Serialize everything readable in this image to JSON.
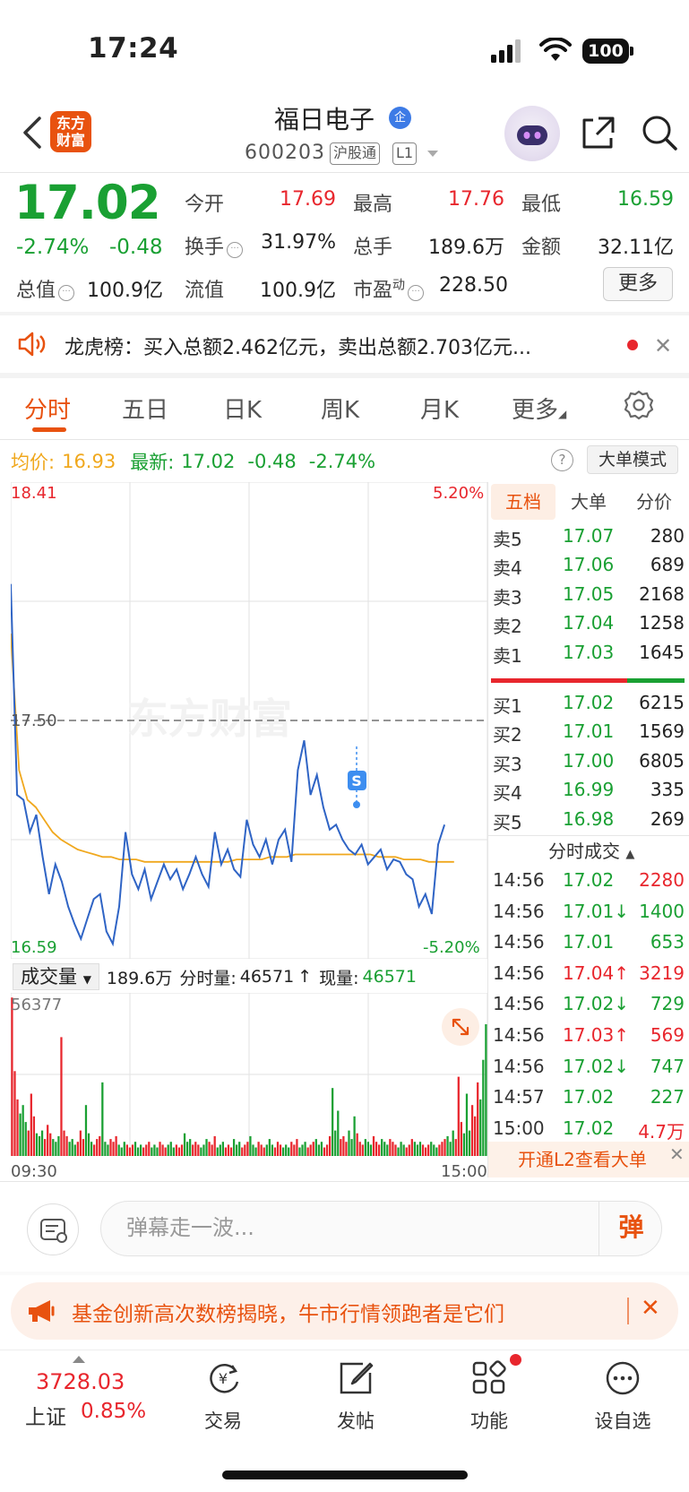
{
  "status_bar": {
    "time": "17:24",
    "battery": "100"
  },
  "header": {
    "logo_text_line1": "东方",
    "logo_text_line2": "财富",
    "stock_name": "福日电子",
    "qi_badge": "企",
    "stock_code": "600203",
    "tag_market": "沪股通",
    "tag_level": "L1"
  },
  "quote": {
    "price": "17.02",
    "change_pct": "-2.74%",
    "change_abs": "-0.48",
    "open_label": "今开",
    "open": "17.69",
    "high_label": "最高",
    "high": "17.76",
    "low_label": "最低",
    "low": "16.59",
    "turnover_label": "换手",
    "turnover": "31.97%",
    "volume_label": "总手",
    "volume": "189.6万",
    "amount_label": "金额",
    "amount": "32.11亿",
    "mktcap_label": "总值",
    "mktcap": "100.9亿",
    "float_label": "流值",
    "float_cap": "100.9亿",
    "pe_label": "市盈",
    "pe_sup": "动",
    "pe": "228.50",
    "more_label": "更多"
  },
  "notice": {
    "text": "龙虎榜：买入总额2.462亿元，卖出总额2.703亿元..."
  },
  "tabs": [
    "分时",
    "五日",
    "日K",
    "周K",
    "月K",
    "更多"
  ],
  "avg_bar": {
    "avg_label": "均价:",
    "avg": "16.93",
    "latest_label": "最新:",
    "latest": "17.02",
    "latest_chg": "-0.48",
    "latest_pct": "-2.74%",
    "help": "?",
    "big_order_mode": "大单模式"
  },
  "chart_labels": {
    "y_top": "18.41",
    "y_mid": "17.50",
    "y_bottom": "16.59",
    "pct_top": "5.20%",
    "pct_bottom": "-5.20%",
    "marker": "S",
    "watermark": "东方财富",
    "vol_dropdown": "成交量",
    "vol_total": "189.6万",
    "vol_fenshi_label": "分时量:",
    "vol_fenshi": "46571",
    "vol_arrow": "↑",
    "vol_now_label": "现量:",
    "vol_now": "46571",
    "vol_max": "56377",
    "x_start": "09:30",
    "x_end": "15:00"
  },
  "chart_data": {
    "type": "line",
    "title": "",
    "ylim": [
      16.59,
      18.41
    ],
    "reference_price": 17.5,
    "series": [
      {
        "name": "",
        "color": "#2f64c5",
        "values": [
          18.05,
          17.2,
          17.18,
          17.05,
          17.12,
          16.95,
          16.8,
          16.92,
          16.85,
          16.75,
          16.68,
          16.62,
          16.7,
          16.78,
          16.8,
          16.65,
          16.6,
          16.75,
          17.05,
          16.88,
          16.82,
          16.9,
          16.78,
          16.85,
          16.92,
          16.86,
          16.9,
          16.82,
          16.88,
          16.95,
          16.88,
          16.83,
          17.05,
          16.92,
          16.98,
          16.9,
          16.87,
          17.1,
          17.0,
          16.95,
          17.02,
          16.92,
          17.02,
          17.06,
          16.93,
          17.3,
          17.42,
          17.2,
          17.28,
          17.15,
          17.06,
          17.08,
          17.02,
          16.98,
          16.96,
          17.0,
          16.92,
          16.95,
          16.98,
          16.9,
          16.94,
          16.93,
          16.88,
          16.86,
          16.75,
          16.8,
          16.72,
          17.0,
          17.08
        ]
      },
      {
        "name": "均价",
        "color": "#f0a81e",
        "values": [
          17.85,
          17.3,
          17.18,
          17.15,
          17.1,
          17.05,
          17.02,
          17.0,
          16.98,
          16.97,
          16.96,
          16.95,
          16.95,
          16.94,
          16.94,
          16.94,
          16.93,
          16.93,
          16.93,
          16.93,
          16.93,
          16.93,
          16.93,
          16.93,
          16.93,
          16.93,
          16.93,
          16.94,
          16.94,
          16.94,
          16.94,
          16.95,
          16.95,
          16.95,
          16.96,
          16.96,
          16.96,
          16.96,
          16.96,
          16.96,
          16.96,
          16.96,
          16.96,
          16.96,
          16.95,
          16.95,
          16.95,
          16.94,
          16.94,
          16.94,
          16.93,
          16.93,
          16.93,
          16.93
        ]
      }
    ],
    "volume": {
      "ymax": 56377,
      "values": [
        56000,
        30000,
        20000,
        15000,
        18000,
        12000,
        9000,
        22000,
        14000,
        8000,
        7000,
        9000,
        6000,
        11000,
        8000,
        6000,
        5000,
        7000,
        42000,
        9000,
        7000,
        5000,
        6000,
        4000,
        5000,
        9000,
        6000,
        18000,
        8000,
        5000,
        4000,
        6000,
        7000,
        26000,
        5000,
        4000,
        6000,
        5000,
        7000,
        4000,
        3000,
        5000,
        4000,
        3000,
        4000,
        5000,
        3000,
        4000,
        3000,
        4000,
        5000,
        3000,
        4000,
        3000,
        5000,
        4000,
        3000,
        4000,
        5000,
        3000,
        4000,
        3000,
        4000,
        8000,
        5000,
        6000,
        4000,
        5000,
        4000,
        3000,
        4000,
        6000,
        5000,
        4000,
        7000,
        3000,
        4000,
        5000,
        3000,
        4000,
        3000,
        6000,
        4000,
        5000,
        3000,
        4000,
        5000,
        7000,
        4000,
        3000,
        5000,
        4000,
        3000,
        4000,
        6000,
        4000,
        3000,
        5000,
        4000,
        3000,
        4000,
        3000,
        5000,
        4000,
        6000,
        3000,
        4000,
        5000,
        3000,
        4000,
        5000,
        6000,
        4000,
        5000,
        3000,
        4000,
        7000,
        24000,
        9000,
        16000,
        6000,
        7000,
        5000,
        9000,
        6000,
        14000,
        8000,
        5000,
        4000,
        6000,
        5000,
        4000,
        7000,
        5000,
        4000,
        6000,
        5000,
        4000,
        6000,
        5000,
        4000,
        3000,
        5000,
        4000,
        3000,
        4000,
        6000,
        5000,
        4000,
        5000,
        4000,
        3000,
        4000,
        5000,
        4000,
        3000,
        4000,
        5000,
        6000,
        7000,
        5000,
        9000,
        6000,
        28000,
        12000,
        8000,
        22000,
        9000,
        18000,
        14000,
        26000,
        20000,
        34000,
        46571
      ]
    }
  },
  "order_book": {
    "tabs": [
      "五档",
      "大单",
      "分价"
    ],
    "asks": [
      {
        "label": "卖5",
        "price": "17.07",
        "vol": "280"
      },
      {
        "label": "卖4",
        "price": "17.06",
        "vol": "689"
      },
      {
        "label": "卖3",
        "price": "17.05",
        "vol": "2168"
      },
      {
        "label": "卖2",
        "price": "17.04",
        "vol": "1258"
      },
      {
        "label": "卖1",
        "price": "17.03",
        "vol": "1645"
      }
    ],
    "bids": [
      {
        "label": "买1",
        "price": "17.02",
        "vol": "6215"
      },
      {
        "label": "买2",
        "price": "17.01",
        "vol": "1569"
      },
      {
        "label": "买3",
        "price": "17.00",
        "vol": "6805"
      },
      {
        "label": "买4",
        "price": "16.99",
        "vol": "335"
      },
      {
        "label": "买5",
        "price": "16.98",
        "vol": "269"
      }
    ]
  },
  "ticks": {
    "title": "分时成交",
    "rows": [
      {
        "time": "14:56",
        "price": "17.02",
        "vol": "2280"
      },
      {
        "time": "14:56",
        "price": "17.01↓",
        "vol": "1400"
      },
      {
        "time": "14:56",
        "price": "17.01",
        "vol": "653"
      },
      {
        "time": "14:56",
        "price": "17.04↑",
        "vol": "3219"
      },
      {
        "time": "14:56",
        "price": "17.02↓",
        "vol": "729"
      },
      {
        "time": "14:56",
        "price": "17.03↑",
        "vol": "569"
      },
      {
        "time": "14:56",
        "price": "17.02↓",
        "vol": "747"
      },
      {
        "time": "14:57",
        "price": "17.02",
        "vol": "227"
      },
      {
        "time": "15:00",
        "price": "17.02",
        "vol": "4.7万"
      }
    ],
    "l2_banner": "开通L2查看大单"
  },
  "danmu": {
    "placeholder": "弹幕走一波...",
    "send": "弹"
  },
  "promo": {
    "text": "基金创新高次数榜揭晓，牛市行情领跑者是它们"
  },
  "bottom_nav": {
    "index_value": "3728.03",
    "index_name": "上证",
    "index_pct": "0.85%",
    "items": [
      "交易",
      "发帖",
      "功能",
      "设自选"
    ]
  },
  "colors": {
    "up": "#e8262d",
    "down": "#1aa033",
    "accent": "#e8520f",
    "price_line": "#2f64c5",
    "avg_line": "#f0a81e"
  }
}
